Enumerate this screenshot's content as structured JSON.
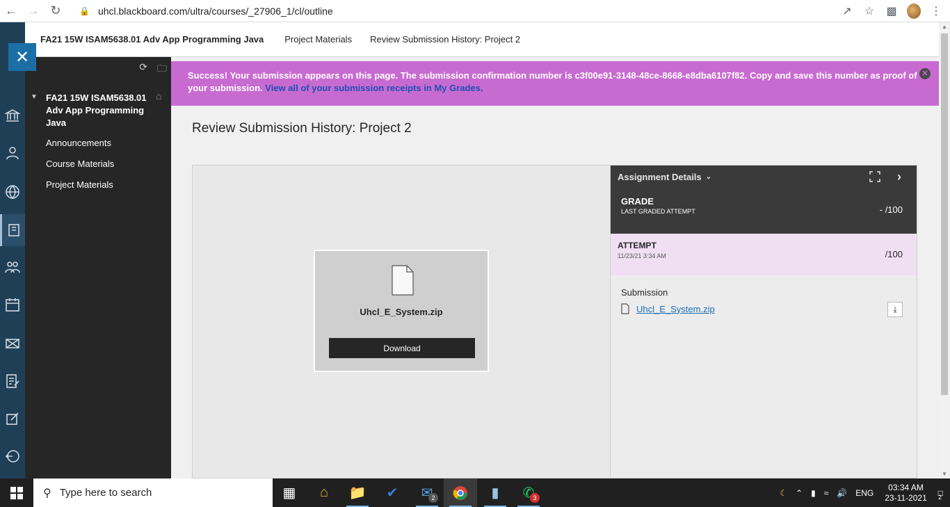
{
  "browser": {
    "url": "uhcl.blackboard.com/ultra/courses/_27906_1/cl/outline"
  },
  "header": {
    "course_title": "FA21 15W ISAM5638.01 Adv App Programming Java",
    "crumb_1": "Project Materials",
    "crumb_2": "Review Submission History: Project 2"
  },
  "sidebar": {
    "course_name": "FA21 15W ISAM5638.01 Adv App Programming Java",
    "items": [
      {
        "label": "Announcements"
      },
      {
        "label": "Course Materials"
      },
      {
        "label": "Project Materials"
      }
    ]
  },
  "banner": {
    "message": "Success! Your submission appears on this page. The submission confirmation number is c3f00e91-3148-48ce-8668-e8dba6107f82. Copy and save this number as proof of your submission.",
    "link": "View all of your submission receipts in My Grades."
  },
  "page": {
    "title": "Review Submission History: Project 2"
  },
  "viewer": {
    "file_name": "Uhcl_E_System.zip",
    "download_label": "Download"
  },
  "details": {
    "header": "Assignment Details",
    "grade_label": "GRADE",
    "grade_sub": "LAST GRADED ATTEMPT",
    "grade_value": "- /100",
    "attempt_label": "ATTEMPT",
    "attempt_date": "11/23/21 3:34 AM",
    "attempt_value": "/100",
    "submission_label": "Submission",
    "submission_file": "Uhcl_E_System.zip"
  },
  "taskbar": {
    "search_placeholder": "Type here to search",
    "mail_badge": "2",
    "whatsapp_badge": "3",
    "lang": "ENG",
    "time": "03:34 AM",
    "date": "23-11-2021",
    "notif_count": "2"
  },
  "colors": {
    "banner": "#c86bd1",
    "rail": "#1f3f57",
    "accent": "#1c6fa6"
  }
}
